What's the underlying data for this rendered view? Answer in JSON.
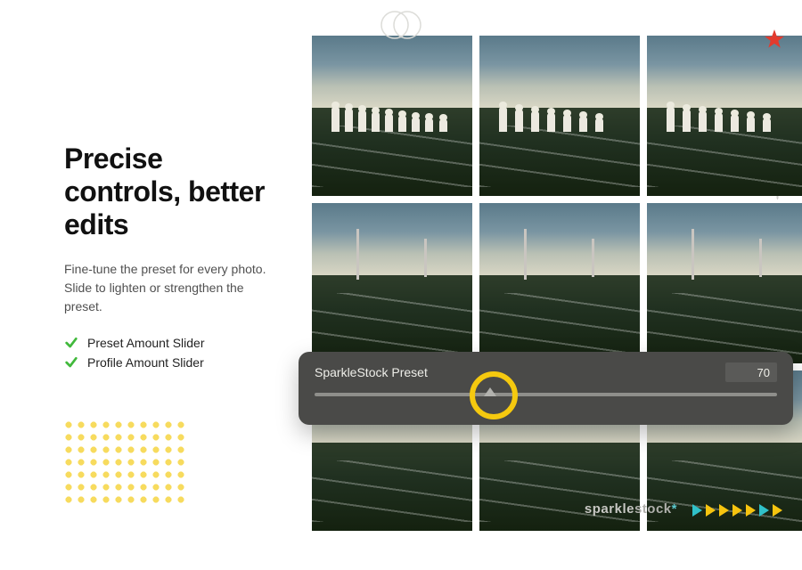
{
  "headline": "Precise controls, better edits",
  "subhead": "Fine-tune the preset for every photo. Slide to lighten or strengthen the preset.",
  "features": [
    {
      "label": "Preset Amount Slider"
    },
    {
      "label": "Profile Amount Slider"
    }
  ],
  "slider": {
    "name": "SparkleStock Preset",
    "value": "70",
    "position_pct": 38,
    "accent": "#f5c90f"
  },
  "brand": {
    "light": "sparkle",
    "bold": "stock"
  },
  "tri_colors": [
    "#30c1c9",
    "#f6c40f",
    "#f6c40f",
    "#f6c40f",
    "#f6c40f",
    "#30c1c9",
    "#f6c40f"
  ],
  "colors": {
    "check": "#41b93c",
    "panel": "#4a4a48"
  }
}
